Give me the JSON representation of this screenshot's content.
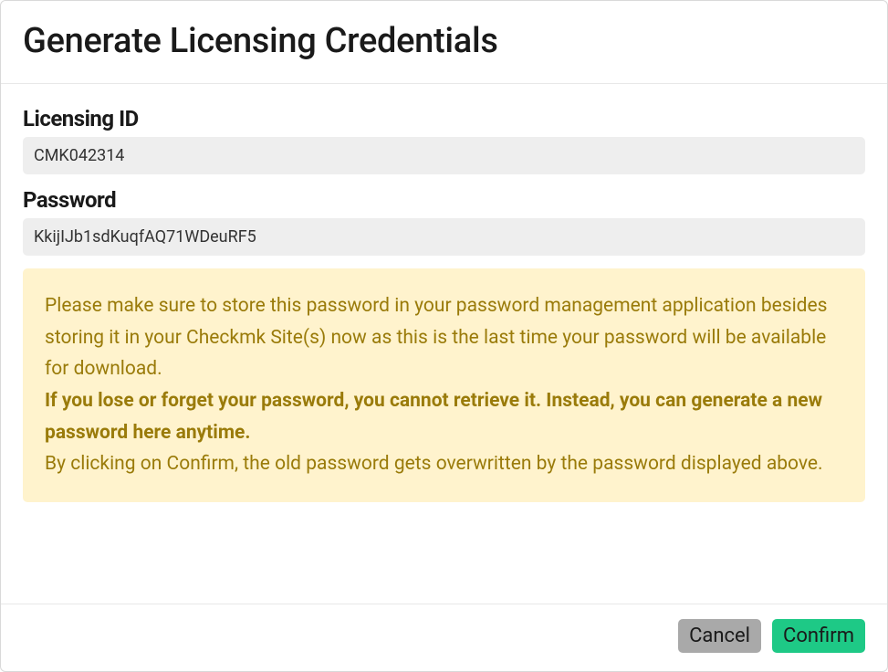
{
  "modal": {
    "title": "Generate Licensing Credentials",
    "licensing_id": {
      "label": "Licensing ID",
      "value": "CMK042314"
    },
    "password": {
      "label": "Password",
      "value": "KkijIJb1sdKuqfAQ71WDeuRF5"
    },
    "warning": {
      "text1": "Please make sure to store this password in your password management application besides storing it in your Checkmk Site(s) now as this is the last time your password will be available for download.",
      "text_bold": "If you lose or forget your password, you cannot retrieve it. Instead, you can generate a new password here anytime.",
      "text2": "By clicking on Confirm, the old password gets overwritten by the password displayed above."
    },
    "footer": {
      "cancel_label": "Cancel",
      "confirm_label": "Confirm"
    }
  }
}
